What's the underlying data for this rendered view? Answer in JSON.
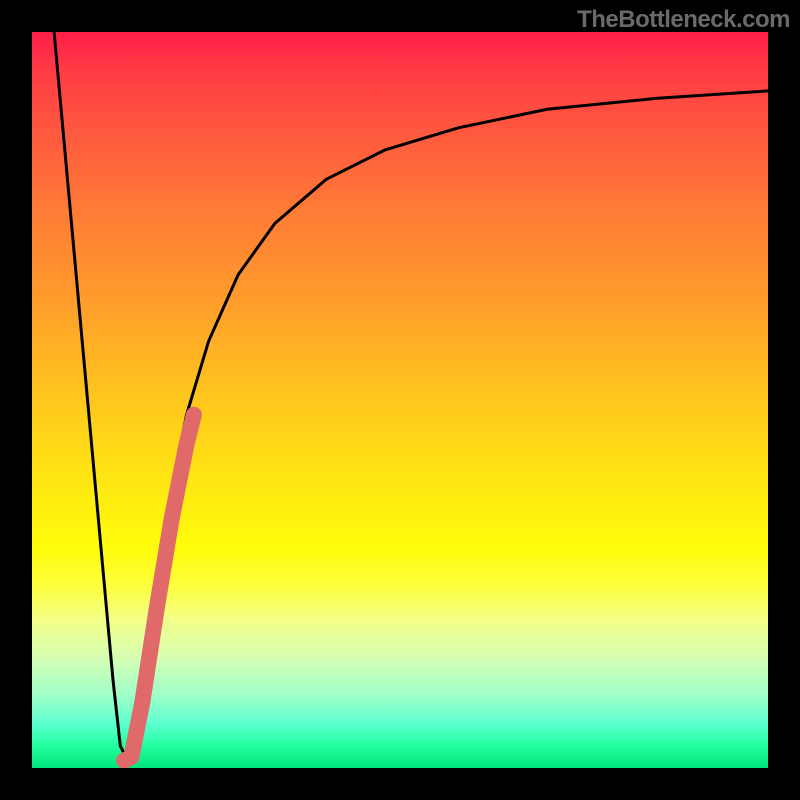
{
  "watermark": "TheBottleneck.com",
  "chart_data": {
    "type": "line",
    "title": "",
    "xlabel": "",
    "ylabel": "",
    "xlim": [
      0,
      100
    ],
    "ylim": [
      0,
      100
    ],
    "grid": false,
    "legend": false,
    "gradient_colors": {
      "top": "#ff1f47",
      "mid_orange": "#ff9b2c",
      "mid_yellow": "#fffc0a",
      "bottom": "#00e57a"
    },
    "series": [
      {
        "name": "bottleneck-curve",
        "color": "#000000",
        "stroke_width": 3,
        "x": [
          3,
          5,
          7,
          9,
          11,
          12,
          13,
          14,
          15,
          17,
          19,
          21,
          24,
          28,
          33,
          40,
          48,
          58,
          70,
          85,
          100
        ],
        "y": [
          100,
          78,
          56,
          34,
          12,
          3,
          1,
          3,
          12,
          26,
          38,
          48,
          58,
          67,
          74,
          80,
          84,
          87,
          89.5,
          91,
          92
        ]
      },
      {
        "name": "highlight-segment",
        "color": "#e06a6a",
        "stroke_width": 16,
        "x": [
          12.5,
          13.5,
          15,
          17,
          19,
          21,
          22
        ],
        "y": [
          1,
          1.5,
          9,
          22,
          34,
          44,
          48
        ]
      }
    ]
  }
}
